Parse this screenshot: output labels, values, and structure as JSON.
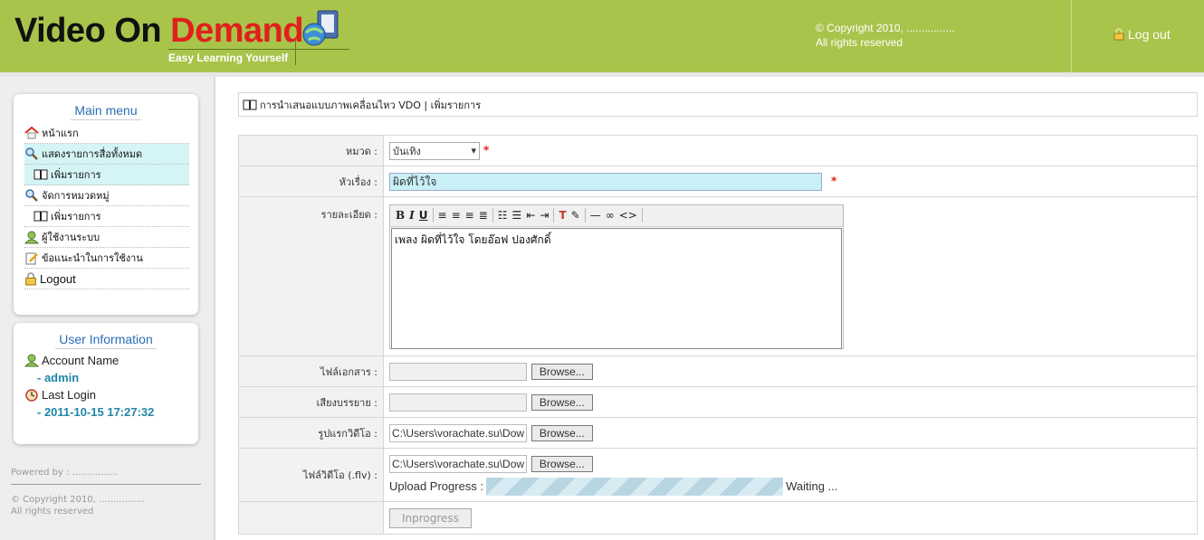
{
  "header": {
    "logo_part1": "Video On ",
    "logo_part2": "Demand",
    "tagline": "Easy Learning Yourself",
    "copyright_line1": "© Copyright 2010, ................",
    "copyright_line2": "All rights reserved",
    "logout_label": "Log out"
  },
  "sidebar": {
    "main_menu_title": "Main menu",
    "items": [
      {
        "label": "หน้าแรก",
        "icon": "home-icon"
      },
      {
        "label": "แสดงรายการสื่อทั้งหมด",
        "icon": "search-icon"
      },
      {
        "label": "เพิ่มรายการ",
        "icon": "book-icon"
      },
      {
        "label": "จัดการหมวดหมู่",
        "icon": "search-icon"
      },
      {
        "label": "เพิ่มรายการ",
        "icon": "book-icon"
      },
      {
        "label": "ผู้ใช้งานระบบ",
        "icon": "user-icon"
      },
      {
        "label": "ข้อแนะนำในการใช้งาน",
        "icon": "note-icon"
      },
      {
        "label": "Logout",
        "icon": "lock-icon"
      }
    ],
    "user_info_title": "User Information",
    "account_label": "Account Name",
    "account_value": "- admin",
    "last_login_label": "Last Login",
    "last_login_value": "- 2011-10-15 17:27:32",
    "powered_by": "Powered by : ................",
    "copyright_line1": "© Copyright 2010, ................",
    "copyright_line2": "All rights reserved"
  },
  "breadcrumb": "การนำเสนอแบบภาพเคลื่อนไหว VDO | เพิ่มรายการ",
  "form": {
    "category_label": "หมวด :",
    "category_value": "บันเทิง",
    "title_label": "หัวเรื่อง :",
    "title_value": "ผิดที่ไว้ใจ",
    "detail_label": "รายละเอียด :",
    "detail_value": "เพลง ผิดที่ไว้ใจ โดยอ๊อฟ ปองศักดิ์",
    "required_mark": "*",
    "doc_label": "ไฟล์เอกสาร :",
    "audio_label": "เสียงบรรยาย :",
    "thumb_label": "รูปแรกวิดีโอ :",
    "thumb_value": "C:\\Users\\vorachate.su\\Dow",
    "video_label": "ไฟล์วิดีโอ (.flv) :",
    "video_value": "C:\\Users\\vorachate.su\\Dow",
    "browse_label": "Browse...",
    "progress_label": "Upload Progress :",
    "progress_status": "Waiting ...",
    "submit_label": "Inprogress"
  },
  "colors": {
    "header_green": "#a9c44b",
    "logo_red": "#e0201c",
    "menu_title_blue": "#2a6db5",
    "info_value_teal": "#1f86a8"
  }
}
